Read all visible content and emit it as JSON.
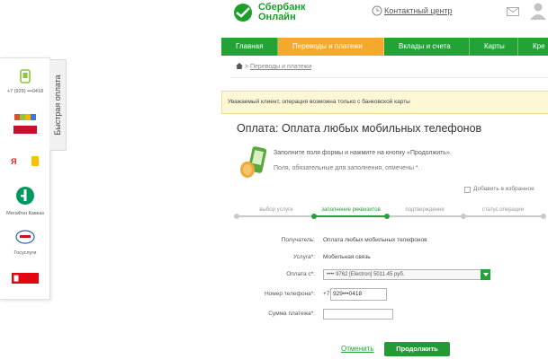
{
  "header": {
    "logo_line1": "Сбербанк",
    "logo_line2": "Онлайн",
    "contact": "Контактный центр"
  },
  "nav": [
    {
      "label": "Главная",
      "active": false
    },
    {
      "label": "Переводы и платежи",
      "active": true
    },
    {
      "label": "Вклады и счета",
      "active": false
    },
    {
      "label": "Карты",
      "active": false
    },
    {
      "label": "Кре",
      "active": false
    }
  ],
  "breadcrumb": "Переводы и платежи",
  "notice": "Уважаемый клиент, операция возможна только с банковской карты",
  "title": "Оплата: Оплата любых мобильных телефонов",
  "hint_fill": "Заполните поля формы и нажмите на кнопку «Продолжить».",
  "hint_required": "Поля, обязательные для заполнения, отмечены *.",
  "favorites": "Добавить в избранное",
  "steps": [
    {
      "label": "выбор услуги",
      "active": false
    },
    {
      "label": "заполнение реквизитов",
      "active": true
    },
    {
      "label": "подтверждение",
      "active": false
    },
    {
      "label": "статус операции",
      "active": false
    }
  ],
  "form": {
    "recipient_label": "Получатель:",
    "recipient_value": "Оплата любых мобильных телефонов",
    "service_label": "Услуга*:",
    "service_value": "Мобильная связь",
    "pay_from_label": "Оплата с*:",
    "pay_from_value": "•••• 9762 [Electron] 5011.45 руб.",
    "phone_label": "Номер телефона*:",
    "phone_prefix": "+7",
    "phone_value": "929•••0418",
    "amount_label": "Сумма платежа*:",
    "amount_value": ""
  },
  "actions": {
    "cancel": "Отменить",
    "submit": "Продолжить"
  },
  "sidebar": {
    "tab": "Быстрая оплата",
    "phone": "+7 (929) •••0418",
    "yandex": "Яндекс",
    "megafon": "МегаФон Кавказ",
    "gosuslugi": "Госуслуги",
    "mts": "МТС"
  },
  "colors": {
    "brand_green": "#23a235",
    "active_nav": "#f4a92d",
    "notice_bg": "#fdf7d6"
  }
}
